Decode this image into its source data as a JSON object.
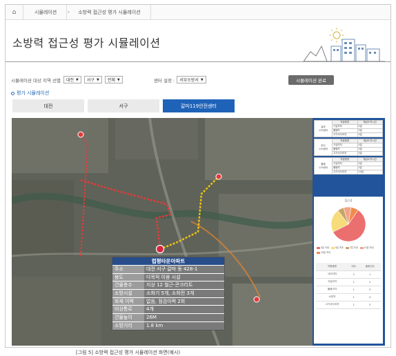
{
  "breadcrumb": {
    "home_icon": "home-icon",
    "items": [
      "시뮬레이션",
      "소방력 접근성 평가 시뮬레이션"
    ]
  },
  "page_title": "소방력 접근성 평가 시뮬레이션",
  "filter": {
    "label": "시뮬레이션 대상 지역 선별",
    "city": "대전",
    "district": "서구",
    "area": "전체"
  },
  "center_setting": {
    "label": "센터 설정 :",
    "value": "서부소방서"
  },
  "run_button": "시뮬레이션 완료",
  "section_label": "평가 시뮬레이션",
  "tabs": [
    "대전",
    "서구",
    "갈마119안전센터"
  ],
  "info_card": {
    "title": "럽평타운아파트",
    "rows": [
      {
        "k": "주소",
        "v": "대전 서구 갈마 동 428-1"
      },
      {
        "k": "용도",
        "v": "다목적 이용 시설"
      },
      {
        "k": "건물층수",
        "v": "지상 12    철근-콘크리트"
      },
      {
        "k": "소방시설",
        "v": "소화기 5개, 소화전 3개"
      },
      {
        "k": "화재 이력",
        "v": "없음, 점검이력   2회"
      },
      {
        "k": "비상통로",
        "v": "4개"
      },
      {
        "k": "건물높이",
        "v": "26M"
      },
      {
        "k": "소방거리",
        "v": "1.8 km"
      }
    ]
  },
  "side_tables": [
    {
      "name": "갈마\n119센터",
      "head": [
        "차량종류",
        "예상도착시간"
      ],
      "rows": [
        [
          "구급차차",
          "5분"
        ],
        [
          "물탱차",
          "3분"
        ],
        [
          "고가사다리차",
          "5분"
        ]
      ]
    },
    {
      "name": "둔산\n119센터",
      "head": [
        "차량종류",
        "예상도착시간"
      ],
      "rows": [
        [
          "구급차차",
          "5분"
        ],
        [
          "물탱차",
          "3분"
        ],
        [
          "고가사다리차",
          "5분"
        ]
      ]
    },
    {
      "name": "월평\n119센터",
      "head": [
        "차량종류",
        "예상도착시간"
      ],
      "rows": [
        [
          "구급차차",
          "5분"
        ],
        [
          "물탱차",
          "3분"
        ],
        [
          "고가사다리차",
          "10분"
        ]
      ]
    }
  ],
  "chart_data": {
    "type": "pie",
    "title": "접근성",
    "slices": [
      {
        "label": "5분 이내",
        "value": 58,
        "color": "#ec6f6f"
      },
      {
        "label": "5분 초과",
        "value": 22,
        "color": "#f6dc7a"
      },
      {
        "label": "7분 이내",
        "value": 6,
        "color": "#c9a46a"
      },
      {
        "label": "10분 이내",
        "value": 7,
        "color": "#f1a484"
      },
      {
        "label": "10분 초과",
        "value": 7,
        "color": "#f08c4e"
      }
    ]
  },
  "stat_table": {
    "head": [
      "차량종류",
      "대수",
      "출동건수"
    ],
    "rows": [
      [
        "사다리차",
        "2",
        "1"
      ],
      [
        "구급차차",
        "1",
        "2"
      ],
      [
        "물탱크차",
        "1",
        "3"
      ],
      [
        "소방차",
        "1",
        "4"
      ],
      [
        "고가사다리차",
        "1",
        "5"
      ]
    ]
  },
  "caption": "[그림 5] 소방력 접근성 평가 시뮬레이션 화면(예시)",
  "colors": {
    "accent": "#1f63b9",
    "route_red": "#e33b3b",
    "route_yellow": "#f1c40f",
    "route_orange": "#e8862e"
  }
}
